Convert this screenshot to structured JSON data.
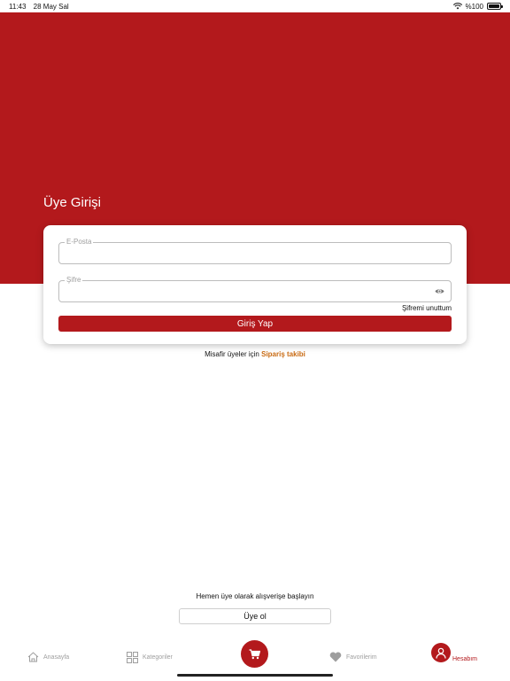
{
  "status": {
    "time": "11:43",
    "date": "28 May Sal",
    "battery": "%100",
    "battery_level": 1.0
  },
  "login": {
    "title": "Üye Girişi",
    "email_label": "E-Posta",
    "email_value": "",
    "password_label": "Şifre",
    "password_value": "",
    "forgot_label": "Şifremi unuttum",
    "submit_label": "Giriş Yap"
  },
  "guest": {
    "prefix": "Misafir üyeler için",
    "link": "Sipariş takibi"
  },
  "signup": {
    "text": "Hemen üye olarak alışverişe başlayın",
    "button": "Üye ol"
  },
  "tabs": [
    {
      "label": "Anasayfa",
      "icon": "home-icon",
      "active": false
    },
    {
      "label": "Kategoriler",
      "icon": "grid-icon",
      "active": false
    },
    {
      "label": "",
      "icon": "cart-icon",
      "active": false
    },
    {
      "label": "Favorilerim",
      "icon": "heart-icon",
      "active": false
    },
    {
      "label": "Hesabım",
      "icon": "user-icon",
      "active": true
    }
  ],
  "colors": {
    "brand": "#b3191c",
    "link": "#c86a12",
    "inactive": "#9e9e9e"
  }
}
